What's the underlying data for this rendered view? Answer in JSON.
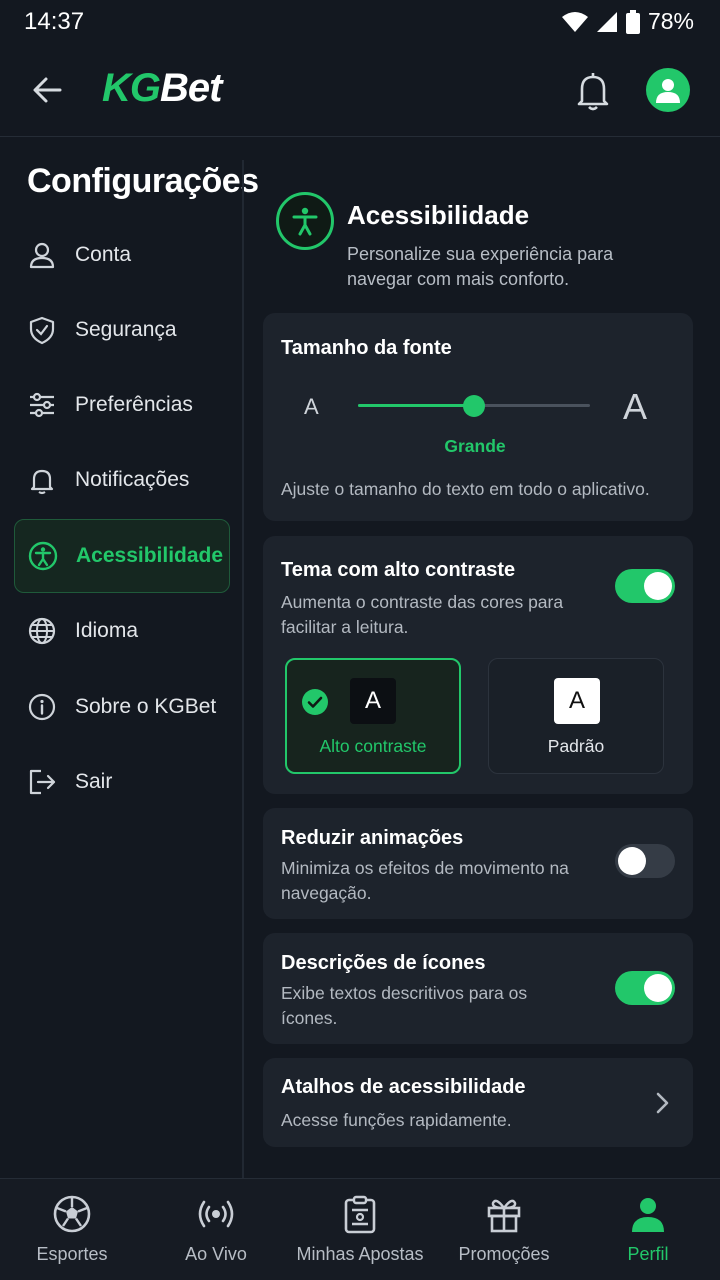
{
  "status_bar": {
    "time": "14:37",
    "battery": "78%"
  },
  "header": {
    "logo_part1": "KG",
    "logo_part2": "Bet"
  },
  "sidebar": {
    "title": "Configurações",
    "items": [
      {
        "label": "Conta",
        "icon": "user-icon"
      },
      {
        "label": "Segurança",
        "icon": "shield-icon"
      },
      {
        "label": "Preferências",
        "icon": "sliders-icon"
      },
      {
        "label": "Notificações",
        "icon": "bell-icon"
      },
      {
        "label": "Acessibilidade",
        "icon": "accessibility-icon",
        "active": true
      },
      {
        "label": "Idioma",
        "icon": "globe-icon"
      },
      {
        "label": "Sobre o KGBet",
        "icon": "info-icon"
      },
      {
        "label": "Sair",
        "icon": "logout-icon"
      }
    ]
  },
  "main": {
    "title": "Acessibilidade",
    "subtitle": "Personalize sua experiência para navegar com mais conforto.",
    "font_size": {
      "title": "Tamanho da fonte",
      "small_label": "A",
      "large_label": "A",
      "value_label": "Grande",
      "level_fraction": 0.5,
      "description": "Ajuste o tamanho do texto em todo o aplicativo."
    },
    "high_contrast": {
      "title": "Tema com alto contraste",
      "description": "Aumenta o contraste das cores para facilitar a leitura.",
      "enabled": true,
      "options": [
        {
          "swatch": "A",
          "label": "Alto contraste",
          "selected": true
        },
        {
          "swatch": "A",
          "label": "Padrão",
          "selected": false
        }
      ]
    },
    "reduce_motion": {
      "title": "Reduzir animações",
      "description": "Minimiza os efeitos de movimento na navegação.",
      "enabled": false
    },
    "icon_descriptions": {
      "title": "Descrições de ícones",
      "description": "Exibe textos descritivos para os ícones.",
      "enabled": true
    },
    "shortcuts": {
      "title": "Atalhos de acessibilidade",
      "description": "Acesse funções rapidamente."
    }
  },
  "bottom_nav": [
    {
      "label": "Esportes",
      "icon": "soccer-ball-icon"
    },
    {
      "label": "Ao Vivo",
      "icon": "live-broadcast-icon"
    },
    {
      "label": "Minhas Apostas",
      "icon": "bet-slip-icon"
    },
    {
      "label": "Promoções",
      "icon": "gift-icon"
    },
    {
      "label": "Perfil",
      "icon": "profile-icon",
      "active": true
    }
  ],
  "colors": {
    "accent": "#22c76a",
    "background": "#131820",
    "card": "#1d232c"
  }
}
